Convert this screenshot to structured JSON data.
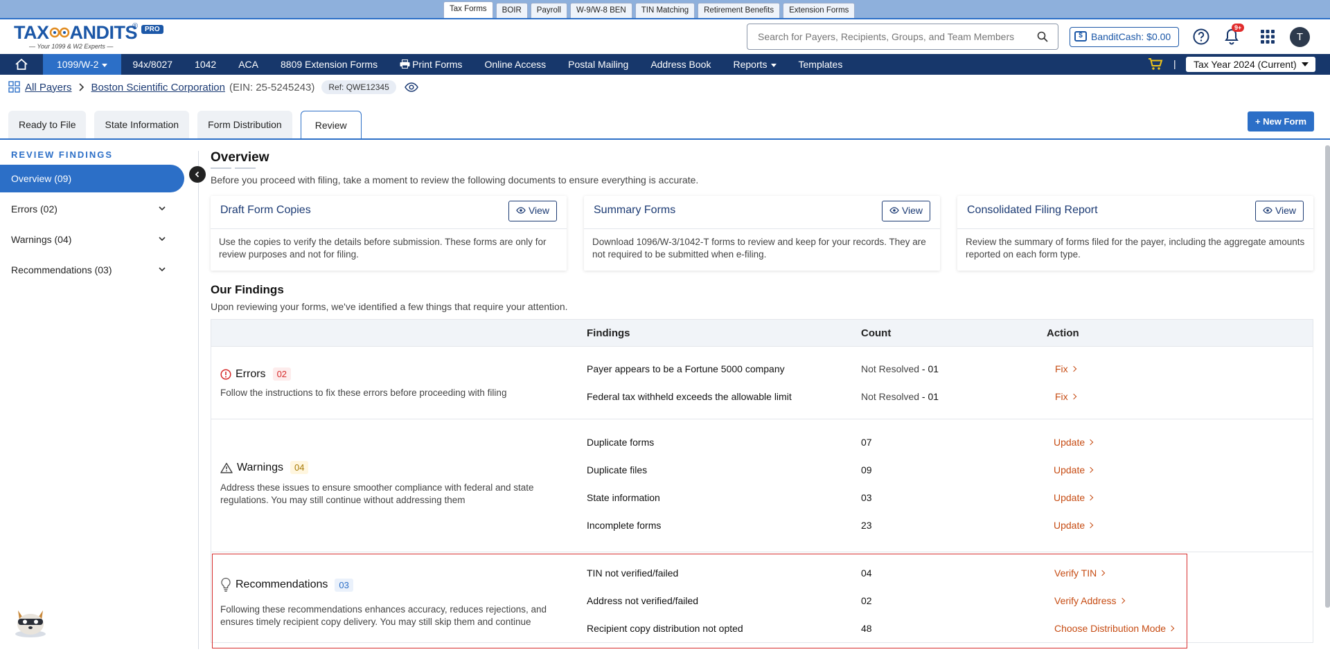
{
  "top_tabs": [
    "Tax Forms",
    "BOIR",
    "Payroll",
    "W-9/W-8 BEN",
    "TIN Matching",
    "Retirement Benefits",
    "Extension Forms"
  ],
  "logo": {
    "brand": "TAXBANDITS",
    "tagline": "Your 1099 & W2 Experts",
    "badge": "PRO",
    "reg": "®"
  },
  "search": {
    "placeholder": "Search for Payers, Recipients, Groups, and Team Members"
  },
  "bandit_cash": {
    "label": "BanditCash: $0.00"
  },
  "notifications": {
    "badge": "9+"
  },
  "avatar": {
    "initial": "T"
  },
  "nav": {
    "items": [
      "1099/W-2",
      "94x/8027",
      "1042",
      "ACA",
      "8809 Extension Forms",
      "Print Forms",
      "Online Access",
      "Postal Mailing",
      "Address Book",
      "Reports",
      "Templates"
    ],
    "separator": "|",
    "tax_year": "Tax Year 2024 (Current)"
  },
  "breadcrumb": {
    "all_payers": "All Payers",
    "payer": "Boston Scientific Corporation",
    "ein": "(EIN: 25-5245243)",
    "ref": "Ref: QWE12345"
  },
  "tabs": [
    "Ready to File",
    "State Information",
    "Form Distribution",
    "Review"
  ],
  "new_form": "+ New Form",
  "sidebar": {
    "heading": "REVIEW FINDINGS",
    "items": [
      "Overview (09)",
      "Errors (02)",
      "Warnings (04)",
      "Recommendations (03)"
    ]
  },
  "overview": {
    "title": "Overview",
    "subtitle": "Before you proceed with filing, take a moment to review the following documents to ensure everything is accurate.",
    "cards": [
      {
        "title": "Draft Form Copies",
        "button": "View",
        "desc": "Use the copies to verify the details before submission. These forms are only for review purposes and not for filing."
      },
      {
        "title": "Summary Forms",
        "button": "View",
        "desc": "Download 1096/W-3/1042-T forms to review and keep for your records. They are not required to be submitted when e-filing."
      },
      {
        "title": "Consolidated Filing Report",
        "button": "View",
        "desc": "Review the summary of forms filed for the payer, including the aggregate amounts reported on each form type."
      }
    ]
  },
  "findings": {
    "title": "Our Findings",
    "subtitle": "Upon reviewing your forms, we've identified a few things that require your attention.",
    "headers": {
      "findings": "Findings",
      "count": "Count",
      "action": "Action"
    },
    "errors": {
      "title": "Errors",
      "count": "02",
      "desc": "Follow the instructions to fix these errors before proceeding with filing",
      "rows": [
        {
          "finding": "Payer appears to be a Fortune 5000 company",
          "status": "Not Resolved",
          "count": " - 01",
          "action": "Fix"
        },
        {
          "finding": "Federal tax withheld exceeds the allowable limit",
          "status": "Not Resolved",
          "count": " - 01",
          "action": "Fix"
        }
      ]
    },
    "warnings": {
      "title": "Warnings",
      "count": "04",
      "desc": "Address these issues to ensure smoother compliance with federal and state regulations. You may still continue without addressing them",
      "rows": [
        {
          "finding": "Duplicate forms",
          "count": "07",
          "action": "Update"
        },
        {
          "finding": "Duplicate files",
          "count": "09",
          "action": "Update"
        },
        {
          "finding": "State information",
          "count": "03",
          "action": "Update"
        },
        {
          "finding": "Incomplete forms",
          "count": "23",
          "action": "Update"
        }
      ]
    },
    "recommendations": {
      "title": "Recommendations",
      "count": "03",
      "desc": "Following these recommendations enhances accuracy, reduces rejections, and ensures timely recipient copy delivery. You may still skip them and continue",
      "rows": [
        {
          "finding": "TIN not verified/failed",
          "count": "04",
          "action": "Verify TIN"
        },
        {
          "finding": "Address not verified/failed",
          "count": "02",
          "action": "Verify Address"
        },
        {
          "finding": "Recipient copy distribution not opted",
          "count": "48",
          "action": "Choose Distribution Mode"
        }
      ]
    }
  },
  "colors": {
    "primary": "#2c6fc7",
    "nav": "#17376b",
    "action": "#c64b12",
    "error": "#d62b2b",
    "warning": "#b8860b"
  }
}
